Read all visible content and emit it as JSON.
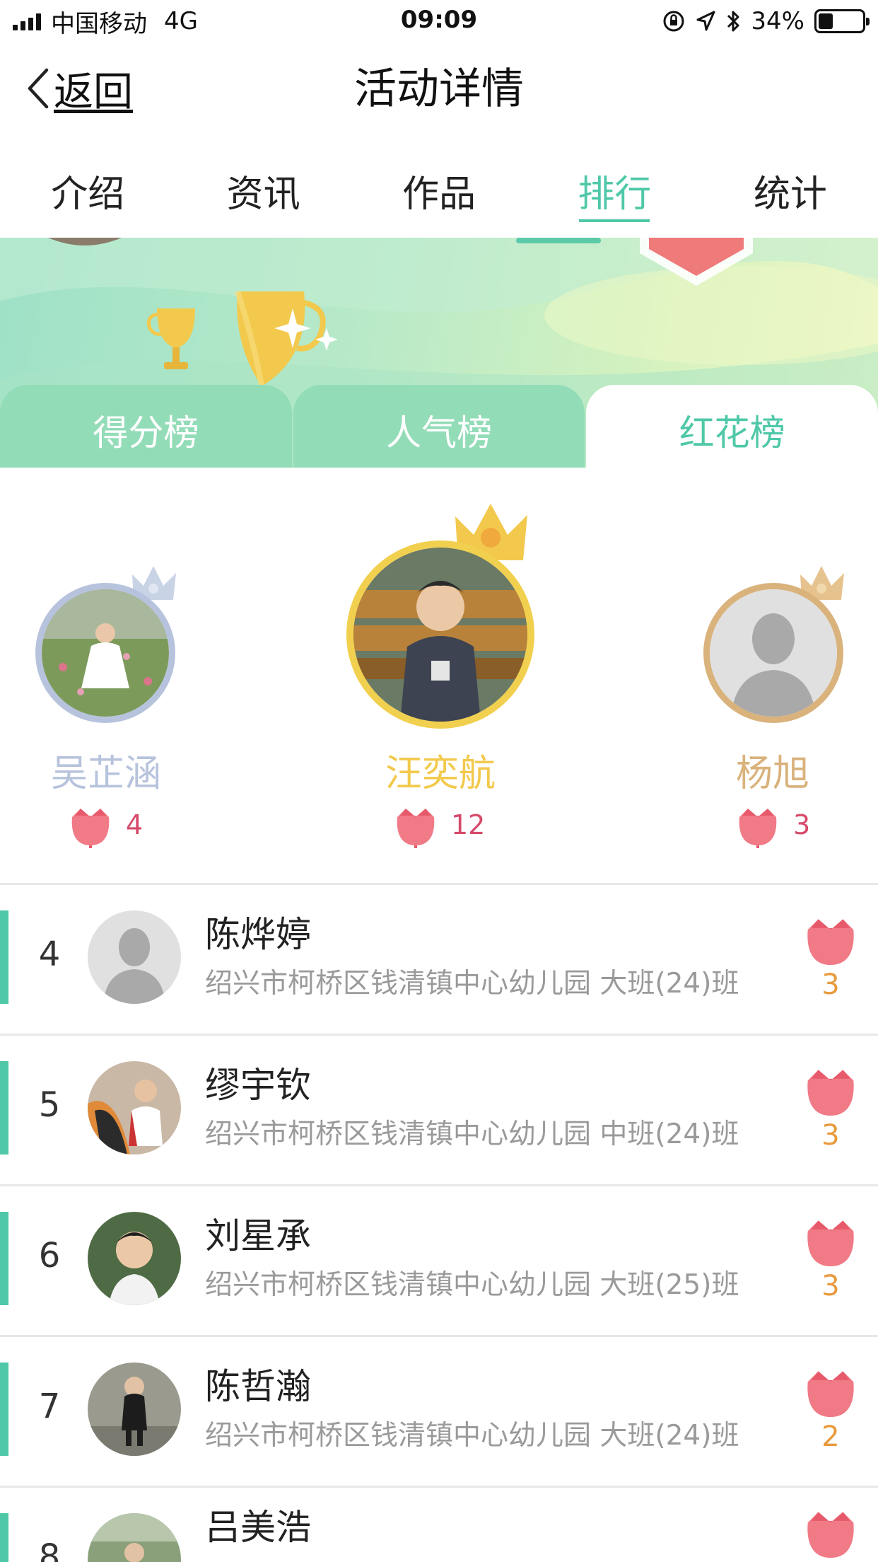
{
  "status_bar": {
    "carrier": "中国移动",
    "network": "4G",
    "time": "09:09",
    "battery": "34%",
    "battery_level": 0.34
  },
  "nav": {
    "back_label": "返回",
    "title": "活动详情"
  },
  "main_tabs": [
    {
      "label": "介绍"
    },
    {
      "label": "资讯"
    },
    {
      "label": "作品"
    },
    {
      "label": "排行"
    },
    {
      "label": "统计"
    }
  ],
  "active_main_tab": "排行",
  "sub_tabs": [
    {
      "label": "得分榜"
    },
    {
      "label": "人气榜"
    },
    {
      "label": "红花榜"
    }
  ],
  "active_sub_tab": "红花榜",
  "podium": {
    "first": {
      "name": "汪奕航",
      "flowers": "12"
    },
    "second": {
      "name": "吴芷涵",
      "flowers": "4"
    },
    "third": {
      "name": "杨旭",
      "flowers": "3"
    }
  },
  "ranking": [
    {
      "rank": "4",
      "name": "陈烨婷",
      "school": "绍兴市柯桥区钱清镇中心幼儿园 大班(24)班",
      "flowers": "3"
    },
    {
      "rank": "5",
      "name": "缪宇钦",
      "school": "绍兴市柯桥区钱清镇中心幼儿园 中班(24)班",
      "flowers": "3"
    },
    {
      "rank": "6",
      "name": "刘星承",
      "school": "绍兴市柯桥区钱清镇中心幼儿园 大班(25)班",
      "flowers": "3"
    },
    {
      "rank": "7",
      "name": "陈哲瀚",
      "school": "绍兴市柯桥区钱清镇中心幼儿园 大班(24)班",
      "flowers": "2"
    },
    {
      "rank": "8",
      "name": "吕美浩",
      "school": "",
      "flowers": ""
    }
  ],
  "colors": {
    "accent": "#4fc8a8",
    "gold": "#f2c94c",
    "silver": "#b7c3dd",
    "bronze": "#d9b27c",
    "flower": "#f07a86",
    "count": "#e89a3c"
  }
}
